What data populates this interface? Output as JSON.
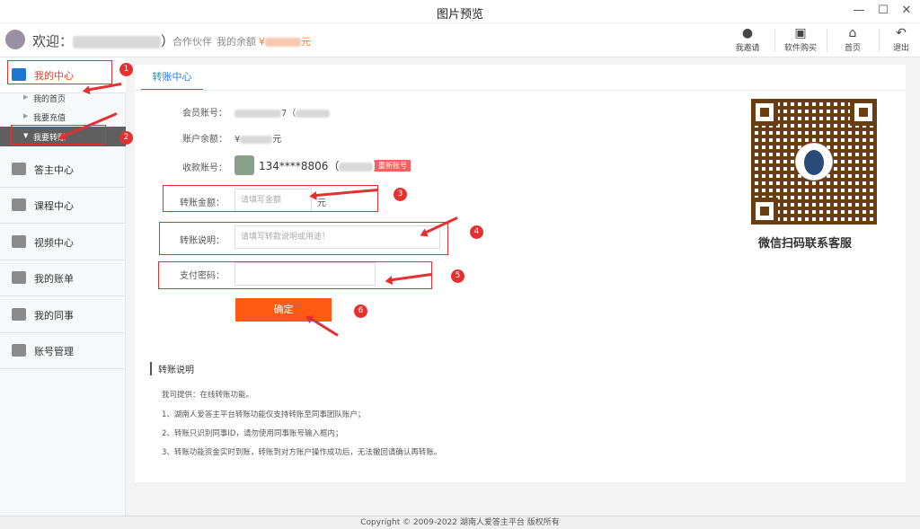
{
  "window": {
    "title": "图片预览",
    "minimize": "—",
    "maximize": "☐",
    "close": "✕"
  },
  "header": {
    "welcome_prefix": "欢迎：",
    "welcome_suffix": "）",
    "partner": "合作伙伴",
    "balance_label": "我的余额",
    "balance_prefix": "¥",
    "balance_suffix": "元",
    "buttons": [
      {
        "label": "我邀请",
        "icon": "person-icon"
      },
      {
        "label": "软件购买",
        "icon": "cart-icon"
      },
      {
        "label": "首页",
        "icon": "home-icon"
      },
      {
        "label": "退出",
        "icon": "exit-icon"
      }
    ]
  },
  "sidebar": {
    "main": [
      {
        "label": "我的中心",
        "icon": "home-icon"
      },
      {
        "label": "答主中心",
        "icon": "box-icon"
      },
      {
        "label": "课程中心",
        "icon": "book-icon"
      },
      {
        "label": "视频中心",
        "icon": "video-icon"
      },
      {
        "label": "我的账单",
        "icon": "bill-icon"
      },
      {
        "label": "我的同事",
        "icon": "people-icon"
      },
      {
        "label": "账号管理",
        "icon": "gear-icon"
      }
    ],
    "sub": [
      {
        "label": "我的首页"
      },
      {
        "label": "我要充值"
      },
      {
        "label": "我要转账"
      }
    ]
  },
  "transfer": {
    "tab": "转账中心",
    "member_label": "会员账号：",
    "member_value": "7（",
    "balance_label": "账户余额：",
    "balance_prefix": "¥",
    "balance_suffix": "元",
    "payee_label": "收款账号：",
    "payee_value": "134****8806（",
    "payee_close": "）",
    "renew_tag": "重新账号",
    "amount_label": "转账金额：",
    "amount_placeholder": "请填写金额",
    "amount_unit": "元",
    "note_label": "转账说明：",
    "note_placeholder": "请填写转款说明或用途！",
    "password_label": "支付密码：",
    "confirm": "确定"
  },
  "annotations": [
    "1",
    "2",
    "3",
    "4",
    "5",
    "6"
  ],
  "qr": {
    "caption": "微信扫码联系客服"
  },
  "notes": {
    "title": "转账说明",
    "lines": [
      "我司提供：在线转账功能。",
      "1、湖南人爱答主平台转账功能仅支持转账至同事团队账户；",
      "2、转账只识别同事ID，请勿使用同事账号输入框内；",
      "3、转账功能资金实时到账，转账到对方账户操作成功后，无法撤回请确认再转账。"
    ]
  },
  "footer": "Copyright © 2009-2022  湖南人爱答主平台 版权所有"
}
